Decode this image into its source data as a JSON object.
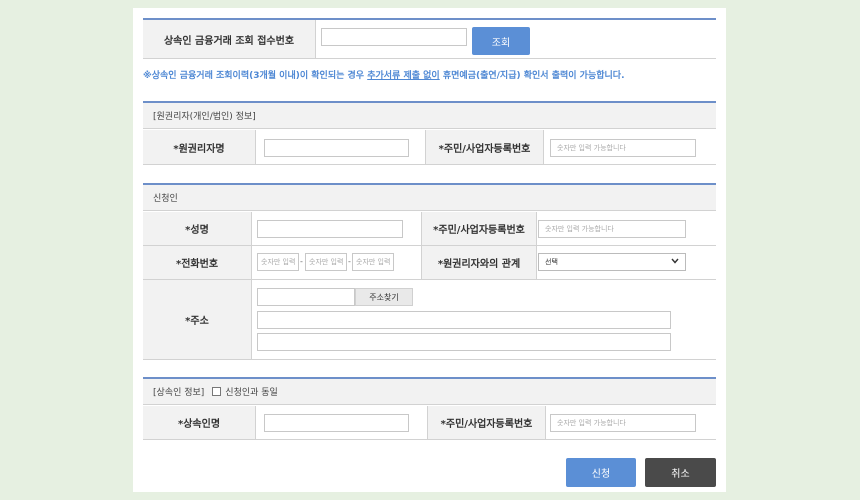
{
  "lookup": {
    "label": "상속인 금융거래 조회 접수번호",
    "input_value": "",
    "button": "조회"
  },
  "notice": {
    "prefix": "※상속인 금융거래 조회이력(3개월 이내)이 확인되는 경우 ",
    "underline": "추가서류 제출 없이",
    "suffix": " 휴면예금(출연/지급) 확인서 출력이 가능합니다."
  },
  "rights_holder": {
    "section_title": "[원권리자(개인/법인) 정보]",
    "name_label": "*원권리자명",
    "name_value": "",
    "id_label": "*주민/사업자등록번호",
    "id_placeholder": "숫자만 입력 가능합니다"
  },
  "applicant": {
    "section_title": "신청인",
    "name_label": "*성명",
    "name_value": "",
    "id_label": "*주민/사업자등록번호",
    "id_placeholder": "숫자만 입력 가능합니다",
    "phone_label": "*전화번호",
    "phone_placeholder_1": "숫자만 입력",
    "phone_placeholder_2": "숫자만 입력",
    "phone_placeholder_3": "숫자만 입력",
    "phone_separator": "-",
    "relation_label": "*원권리자와의 관계",
    "relation_selected": "선택",
    "address_label": "*주소",
    "address_search_button": "주소찾기",
    "zip_value": "",
    "address1_value": "",
    "address2_value": ""
  },
  "heir": {
    "section_title": "[상속인 정보]",
    "same_checkbox_label": "신청인과 동일",
    "name_label": "*상속인명",
    "name_value": "",
    "id_label": "*주민/사업자등록번호",
    "id_placeholder": "숫자만 입력 가능합니다"
  },
  "actions": {
    "submit": "신청",
    "cancel": "취소"
  },
  "colors": {
    "accent": "#5b8fd6",
    "section_line": "#6d8fc9",
    "cancel": "#4a4a4a",
    "background": "#e6f0e1"
  },
  "icons": {
    "select_arrow": "chevron-down-icon",
    "checkbox": "checkbox-icon"
  }
}
